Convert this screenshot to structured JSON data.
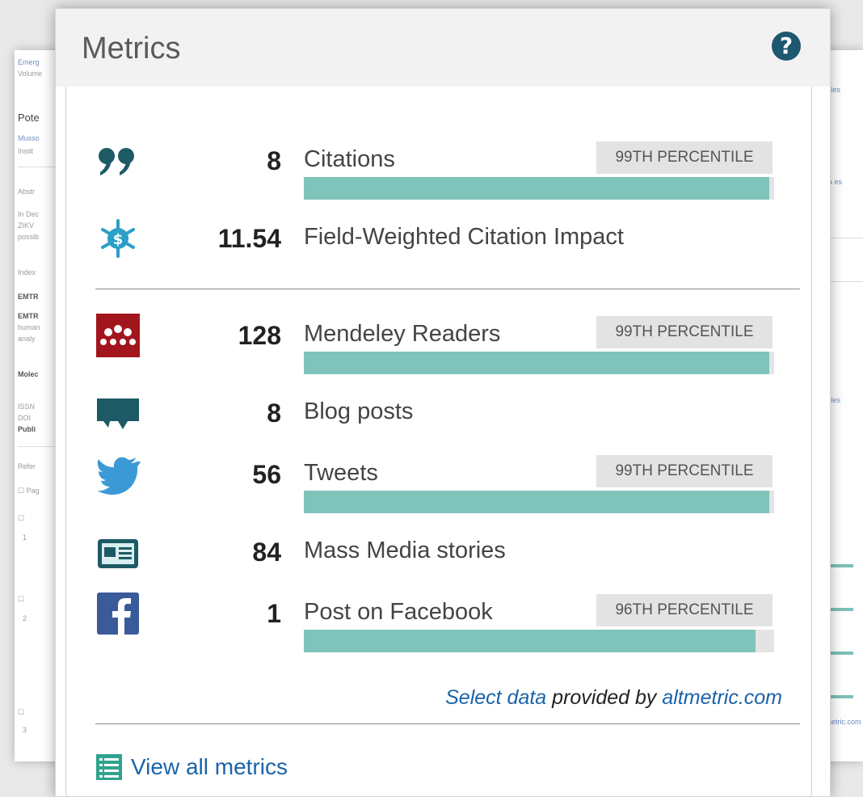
{
  "header": {
    "title": "Metrics",
    "help_glyph": "?"
  },
  "rows": [
    {
      "id": "citations",
      "icon": "quote-icon",
      "value": "8",
      "label": "Citations",
      "percentile": "99TH PERCENTILE",
      "bar_fraction": 0.99
    },
    {
      "id": "fwci",
      "icon": "snowflake-dollar-icon",
      "value": "11.54",
      "label": "Field-Weighted Citation Impact"
    },
    {
      "id": "mendeley",
      "icon": "mendeley-icon",
      "value": "128",
      "label": "Mendeley Readers",
      "percentile": "99TH PERCENTILE",
      "bar_fraction": 0.99
    },
    {
      "id": "blogs",
      "icon": "speech-bubble-icon",
      "value": "8",
      "label": "Blog posts"
    },
    {
      "id": "tweets",
      "icon": "twitter-bird-icon",
      "value": "56",
      "label": "Tweets",
      "percentile": "99TH PERCENTILE",
      "bar_fraction": 0.99
    },
    {
      "id": "media",
      "icon": "newspaper-icon",
      "value": "84",
      "label": "Mass Media stories"
    },
    {
      "id": "facebook",
      "icon": "facebook-icon",
      "value": "1",
      "label": "Post on Facebook",
      "percentile": "96TH PERCENTILE",
      "bar_fraction": 0.96
    }
  ],
  "footer": {
    "select_data_link": "Select data",
    "provided_by": " provided by ",
    "altmetric_link": "altmetric.com",
    "view_all_label": "View all metrics"
  },
  "colors": {
    "bar_fill": "#7fc3bb",
    "bar_track": "#e4e4e4",
    "link": "#1a63a8",
    "help_icon": "#1f5670"
  }
}
